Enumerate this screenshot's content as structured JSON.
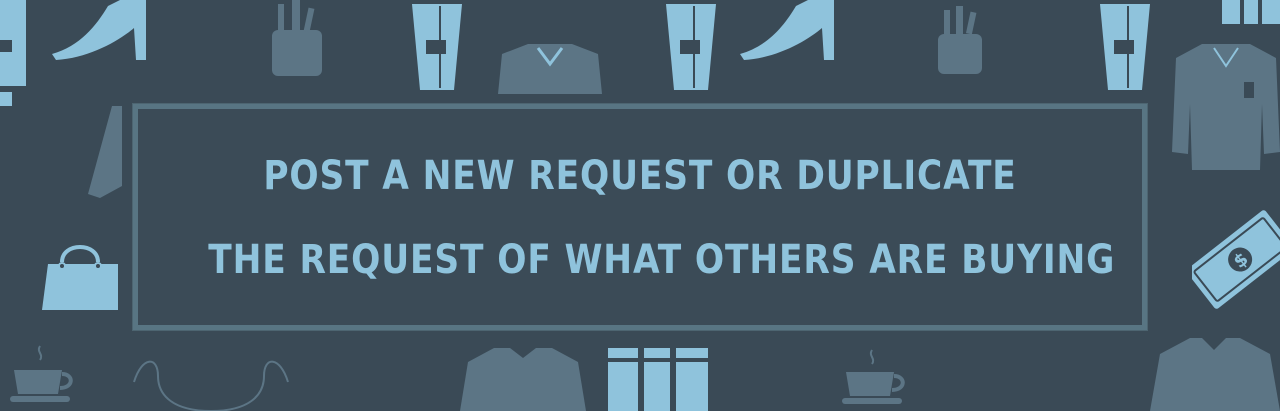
{
  "banner": {
    "headline_line1": "POST A NEW REQUEST OR DUPLICATE",
    "headline_line2": "THE REQUEST OF WHAT OTHERS ARE BUYING"
  },
  "icons": [
    "bottle-icon",
    "high-heel-icon",
    "pencil-cup-icon",
    "glass-icon",
    "sweater-icon",
    "glass-icon",
    "high-heel-icon",
    "pencil-cup-icon",
    "glass-icon",
    "gift-box-icon",
    "shirt-icon",
    "coat-sleeve-icon",
    "handbag-icon",
    "money-bill-icon",
    "coffee-cup-icon",
    "necklace-icon",
    "sweater-icon",
    "gift-box-icon",
    "coffee-cup-icon",
    "sweater-icon"
  ],
  "colors": {
    "background": "#3a4a56",
    "accent": "#8fc3dc",
    "muted": "#5c7585",
    "frame_border": "#587583"
  }
}
